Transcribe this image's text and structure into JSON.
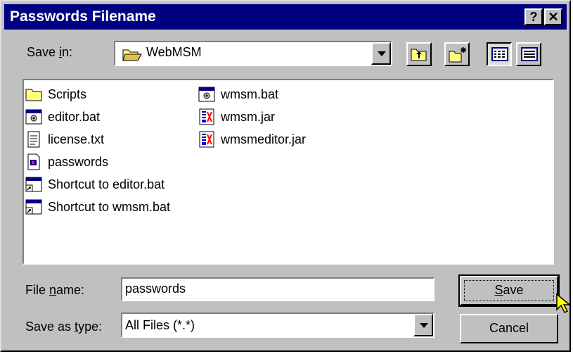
{
  "window": {
    "title": "Passwords Filename",
    "help_label": "?",
    "close_label": "✕"
  },
  "save_in": {
    "label_pre": "Save ",
    "label_accel": "i",
    "label_post": "n:",
    "value": "WebMSM"
  },
  "toolbar": {
    "up_folder": "up-one-level",
    "new_folder": "create-new-folder",
    "list_view": "list-view",
    "details_view": "details-view"
  },
  "files": [
    {
      "name": "Scripts",
      "icon": "folder-icon"
    },
    {
      "name": "editor.bat",
      "icon": "batch-file-icon"
    },
    {
      "name": "license.txt",
      "icon": "text-file-icon"
    },
    {
      "name": "passwords",
      "icon": "generic-file-icon"
    },
    {
      "name": "Shortcut to editor.bat",
      "icon": "shortcut-icon"
    },
    {
      "name": "Shortcut to wmsm.bat",
      "icon": "shortcut-icon"
    },
    {
      "name": "wmsm.bat",
      "icon": "batch-file-icon"
    },
    {
      "name": "wmsm.jar",
      "icon": "jar-file-icon"
    },
    {
      "name": "wmsmeditor.jar",
      "icon": "jar-file-icon"
    }
  ],
  "file_name": {
    "label_pre": "File ",
    "label_accel": "n",
    "label_post": "ame:",
    "value": "passwords"
  },
  "save_as_type": {
    "label_pre": "Save as ",
    "label_accel": "t",
    "label_post": "ype:",
    "value": "All Files (*.*)"
  },
  "buttons": {
    "save_accel": "S",
    "save_rest": "ave",
    "cancel": "Cancel"
  }
}
